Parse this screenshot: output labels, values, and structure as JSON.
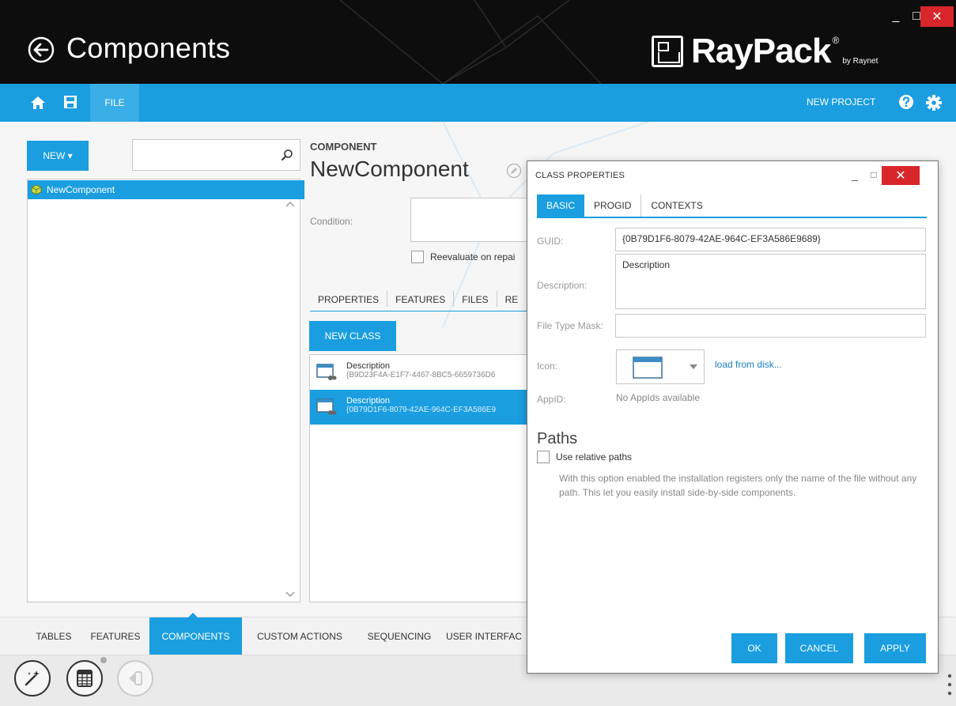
{
  "window": {
    "title": "Components",
    "logo": {
      "name": "RayPack",
      "reg": "®",
      "by": "by Raynet"
    },
    "minimize": "_",
    "maximize": "□",
    "close": "✕"
  },
  "ribbon": {
    "file_tab": "FILE",
    "new_project": "NEW PROJECT"
  },
  "left": {
    "new_button": "NEW ▾",
    "search_value": "",
    "tree_items": [
      {
        "label": "NewComponent"
      }
    ]
  },
  "component": {
    "section_label": "COMPONENT",
    "name": "NewComponent",
    "condition_label": "Condition:",
    "reevaluate_label": "Reevaluate on repai",
    "tabs": [
      "PROPERTIES",
      "FEATURES",
      "FILES",
      "RE"
    ],
    "new_class_button": "NEW CLASS",
    "classes": [
      {
        "name": "Description",
        "guid": "{B9D23F4A-E1F7-4467-8BC5-6659736D6"
      },
      {
        "name": "Description",
        "guid": "{0B79D1F6-8079-42AE-964C-EF3A586E9"
      }
    ]
  },
  "bottom_nav": {
    "items": [
      "TABLES",
      "FEATURES",
      "COMPONENTS",
      "CUSTOM ACTIONS",
      "SEQUENCING",
      "USER INTERFAC"
    ],
    "active": "COMPONENTS"
  },
  "dialog": {
    "title": "CLASS PROPERTIES",
    "minimize": "_",
    "maximize": "□",
    "close": "✕",
    "tabs": [
      "BASIC",
      "PROGID",
      "CONTEXTS"
    ],
    "active_tab": "BASIC",
    "guid_label": "GUID:",
    "guid_value": "{0B79D1F6-8079-42AE-964C-EF3A586E9689}",
    "description_label": "Description:",
    "description_value": "Description",
    "file_type_mask_label": "File Type Mask:",
    "file_type_mask_value": "",
    "icon_label": "Icon:",
    "load_from_disk": "load from disk...",
    "appid_label": "AppID:",
    "appid_value": "No AppIds available",
    "paths_heading": "Paths",
    "use_relative_paths": "Use relative paths",
    "relative_paths_description": "With this option enabled the installation registers only the name of the file without any path. This let you easily install side-by-side components.",
    "ok_button": "OK",
    "cancel_button": "CANCEL",
    "apply_button": "APPLY"
  },
  "colors": {
    "accent": "#1a9ee0",
    "titlebar": "#0d0d0d",
    "close": "#d9262b"
  }
}
